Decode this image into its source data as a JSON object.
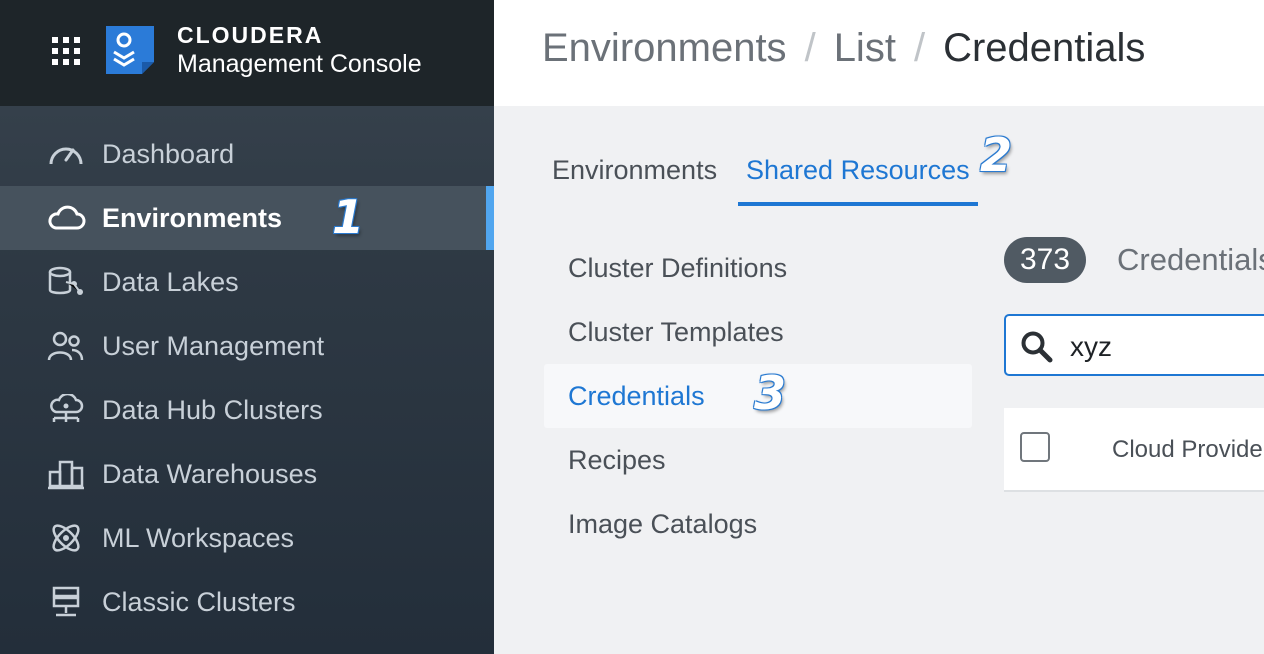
{
  "brand": {
    "name": "CLOUDERA",
    "product": "Management Console"
  },
  "sidebar": {
    "items": [
      {
        "label": "Dashboard",
        "icon": "gauge-icon"
      },
      {
        "label": "Environments",
        "icon": "cloud-icon",
        "active": true
      },
      {
        "label": "Data Lakes",
        "icon": "data-lake-icon"
      },
      {
        "label": "User Management",
        "icon": "users-icon"
      },
      {
        "label": "Data Hub Clusters",
        "icon": "data-hub-icon"
      },
      {
        "label": "Data Warehouses",
        "icon": "warehouse-icon"
      },
      {
        "label": "ML Workspaces",
        "icon": "ml-atom-icon"
      },
      {
        "label": "Classic Clusters",
        "icon": "server-icon"
      }
    ]
  },
  "breadcrumb": {
    "items": [
      "Environments",
      "List",
      "Credentials"
    ],
    "separator": "/"
  },
  "tabs": [
    {
      "label": "Environments"
    },
    {
      "label": "Shared Resources",
      "active": true
    }
  ],
  "subnav": {
    "items": [
      {
        "label": "Cluster Definitions"
      },
      {
        "label": "Cluster Templates"
      },
      {
        "label": "Credentials",
        "active": true
      },
      {
        "label": "Recipes"
      },
      {
        "label": "Image Catalogs"
      }
    ]
  },
  "content": {
    "count": "373",
    "count_label": "Credentials",
    "search": {
      "value": "xyz"
    },
    "table": {
      "columns": [
        "Cloud Provider"
      ]
    }
  },
  "annotations": {
    "step1": "1",
    "step2": "2",
    "step3": "3"
  },
  "colors": {
    "accent": "#1e77d3",
    "sidebar": "#2e3944",
    "header_dark": "#1e2529"
  }
}
